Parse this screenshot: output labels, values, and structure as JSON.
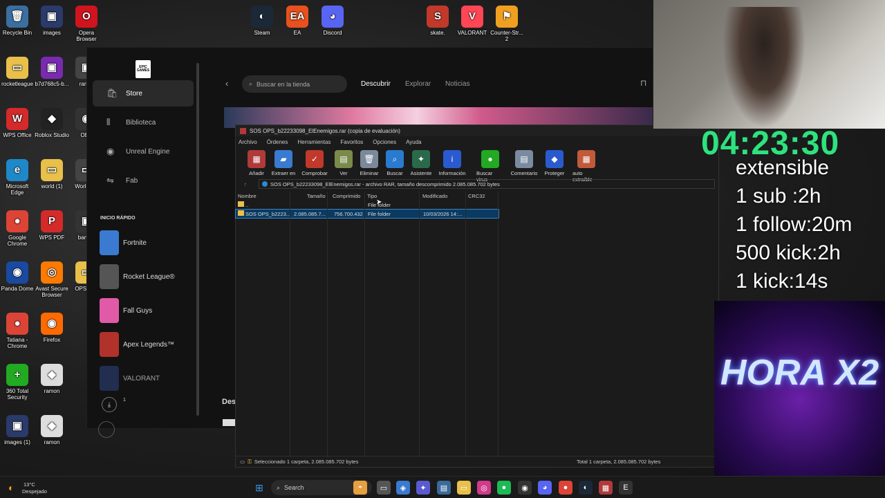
{
  "desktop": {
    "icons": [
      {
        "label": "Recycle Bin",
        "glyph": "🗑",
        "color": "#3a6fa0"
      },
      {
        "label": "images",
        "glyph": "▣",
        "color": "#2a3a6a"
      },
      {
        "label": "Opera Browser",
        "glyph": "O",
        "color": "#d0141e"
      },
      {
        "label": "rocketleague",
        "glyph": "▭",
        "color": "#e8c04a"
      },
      {
        "label": "b7d768c5-b...",
        "glyph": "▣",
        "color": "#7a2ab0"
      },
      {
        "label": "WPS Office",
        "glyph": "W",
        "color": "#d42a2a"
      },
      {
        "label": "Roblox Studio",
        "glyph": "◆",
        "color": "#222"
      },
      {
        "label": "Microsoft Edge",
        "glyph": "e",
        "color": "#1e88c8"
      },
      {
        "label": "world (1)",
        "glyph": "▭",
        "color": "#e8c04a"
      },
      {
        "label": "Google Chrome",
        "glyph": "●",
        "color": "#db4437"
      },
      {
        "label": "WPS PDF",
        "glyph": "P",
        "color": "#d42a2a"
      },
      {
        "label": "Panda Dome",
        "glyph": "◉",
        "color": "#1a4aa0"
      },
      {
        "label": "Avast Secure Browser",
        "glyph": "◎",
        "color": "#ff7a00"
      },
      {
        "label": "Tatiana - Chrome",
        "glyph": "●",
        "color": "#db4437"
      },
      {
        "label": "Firefox",
        "glyph": "◉",
        "color": "#ff6a00"
      },
      {
        "label": "360 Total Security",
        "glyph": "+",
        "color": "#22aa22"
      },
      {
        "label": "ramon",
        "glyph": "◆",
        "color": "#ddd"
      },
      {
        "label": "images (1)",
        "glyph": "▣",
        "color": "#2a3a6a"
      },
      {
        "label": "ramon",
        "glyph": "◆",
        "color": "#ddd"
      },
      {
        "label": "Steam",
        "glyph": "◐",
        "color": "#1b2838"
      },
      {
        "label": "EA",
        "glyph": "EA",
        "color": "#e8501e"
      },
      {
        "label": "Discord",
        "glyph": "◕",
        "color": "#5865f2"
      },
      {
        "label": "skate.",
        "glyph": "S",
        "color": "#c0392b"
      },
      {
        "label": "VALORANT",
        "glyph": "V",
        "color": "#ff4655"
      },
      {
        "label": "Counter-Str... 2",
        "glyph": "⚑",
        "color": "#f0a020"
      },
      {
        "label": "World T...",
        "glyph": "▭",
        "color": "#444"
      },
      {
        "label": "OBS",
        "glyph": "◉",
        "color": "#333"
      },
      {
        "label": "bann...",
        "glyph": "▣",
        "color": "#333"
      },
      {
        "label": "OPS_E...",
        "glyph": "▭",
        "color": "#e8c04a"
      },
      {
        "label": "ram...",
        "glyph": "▣",
        "color": "#444"
      }
    ]
  },
  "epic": {
    "logo": "EPIC GAMES",
    "nav": [
      {
        "label": "Store",
        "icon": "🛍"
      },
      {
        "label": "Biblioteca",
        "icon": "⫴"
      },
      {
        "label": "Unreal Engine",
        "icon": "◉"
      },
      {
        "label": "Fab",
        "icon": "⇋"
      }
    ],
    "quick_title": "INICIO RÁPIDO",
    "games": [
      {
        "label": "Fortnite",
        "color": "#3a7ad0"
      },
      {
        "label": "Rocket League®",
        "color": "#555"
      },
      {
        "label": "Fall Guys",
        "color": "#e05aa8"
      },
      {
        "label": "Apex Legends™",
        "color": "#b0322a"
      },
      {
        "label": "VALORANT",
        "color": "#2a3a6a"
      }
    ],
    "downloads_count": "1",
    "search_placeholder": "Buscar en la tienda",
    "tabs": [
      "Descubrir",
      "Explorar",
      "Noticias"
    ],
    "behind_text": "Des"
  },
  "winrar": {
    "title": "SOS OPS_b22233098_ElEnemigos.rar (copia de evaluación)",
    "menu": [
      "Archivo",
      "Órdenes",
      "Herramientas",
      "Favoritos",
      "Opciones",
      "Ayuda"
    ],
    "toolbar": [
      {
        "label": "Añadir",
        "glyph": "▦",
        "color": "#b03a3a"
      },
      {
        "label": "Extraer en",
        "glyph": "▰",
        "color": "#3a7ad0"
      },
      {
        "label": "Comprobar",
        "glyph": "✓",
        "color": "#c0392b"
      },
      {
        "label": "Ver",
        "glyph": "▤",
        "color": "#7a8a4a"
      },
      {
        "label": "Eliminar",
        "glyph": "🗑",
        "color": "#7a8a9a"
      },
      {
        "label": "Buscar",
        "glyph": "⌕",
        "color": "#2a7ad0"
      },
      {
        "label": "Asistente",
        "glyph": "✦",
        "color": "#2a6a4a"
      },
      {
        "label": "Información",
        "glyph": "i",
        "color": "#2a5ad0"
      },
      {
        "label": "Buscar virus",
        "glyph": "●",
        "color": "#22aa22"
      },
      {
        "label": "Comentario",
        "glyph": "▤",
        "color": "#7a8aa0"
      },
      {
        "label": "Proteger",
        "glyph": "◆",
        "color": "#2a5ad0"
      },
      {
        "label": "auto extraíble",
        "glyph": "▦",
        "color": "#c05a3a"
      }
    ],
    "path": "SOS OPS_b22233098_ElEnemigos.rar - archivo RAR, tamaño descomprimido 2.085.085.702 bytes",
    "columns": [
      "Nombre",
      "Tamaño",
      "Comprimido",
      "Tipo",
      "Modificado",
      "CRC32"
    ],
    "rows": [
      {
        "name": "..",
        "size": "",
        "packed": "",
        "type": "File folder",
        "modified": "",
        "crc": ""
      },
      {
        "name": "SOS OPS_b2223...",
        "size": "2.085.085.7...",
        "packed": "756.700.432",
        "type": "File folder",
        "modified": "10/03/2026 14:...",
        "crc": ""
      }
    ],
    "status_left": "Seleccionado 1 carpeta, 2.085.085.702 bytes",
    "status_right": "Total 1 carpeta, 2.085.085.702 bytes"
  },
  "stream": {
    "timer": "04:23:30",
    "lines": [
      "extensible",
      "1 sub :2h",
      "1 follow:20m",
      "500 kick:2h",
      "1 kick:14s"
    ],
    "promo_text": "HORA X2"
  },
  "taskbar": {
    "temp": "13°C",
    "weather": "Despejado",
    "search": "Search"
  }
}
